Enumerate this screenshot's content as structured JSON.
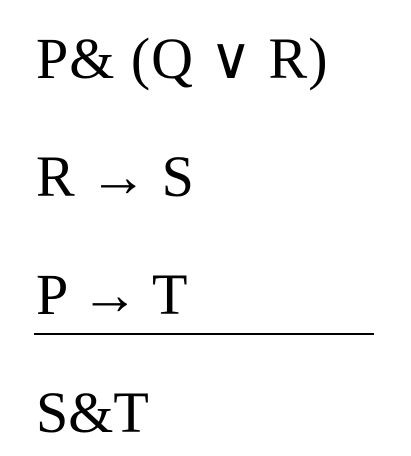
{
  "argument": {
    "premises": [
      "P& (Q ∨ R)",
      "R → S",
      "P → T"
    ],
    "conclusion": "S&T"
  }
}
